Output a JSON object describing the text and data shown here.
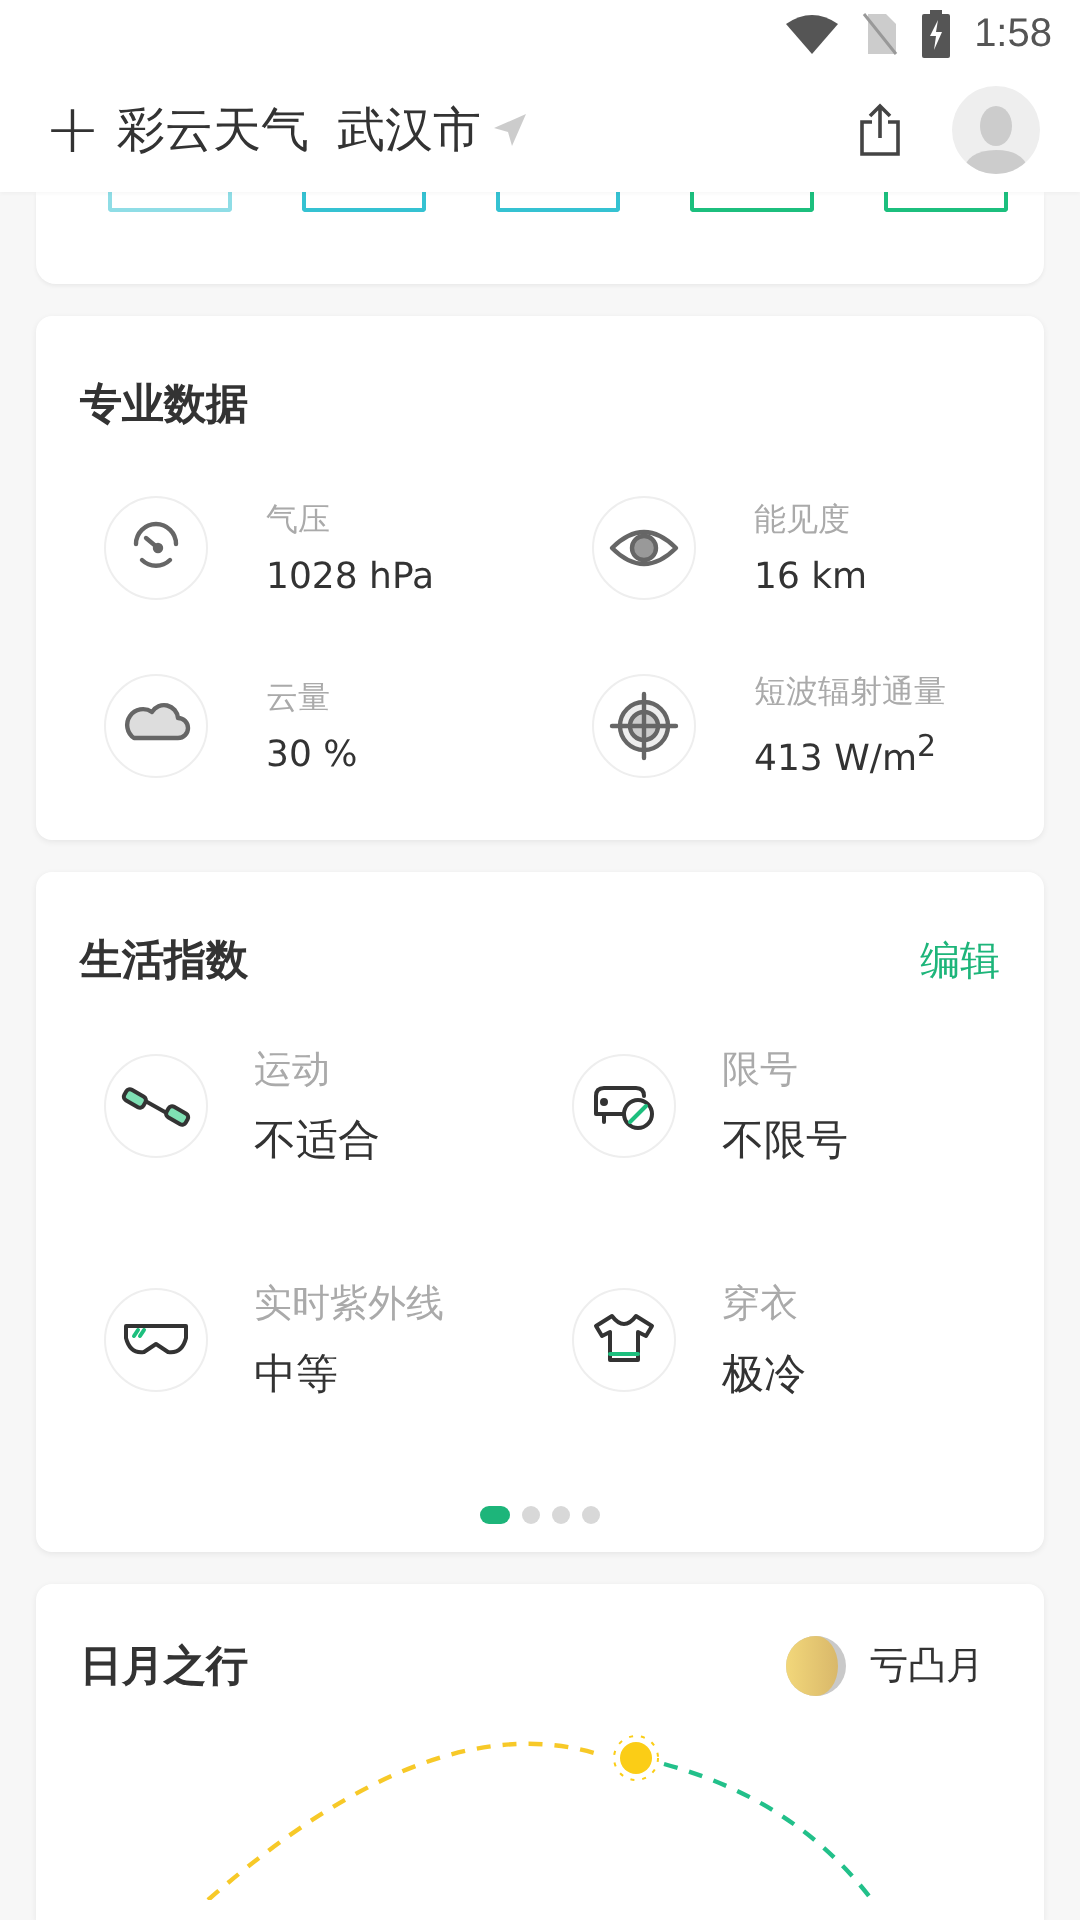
{
  "status_bar": {
    "time": "1:58"
  },
  "header": {
    "add": "+",
    "title": "彩云天气",
    "city": "武汉市"
  },
  "aqi_chips": [
    {
      "color": "#8fdde6"
    },
    {
      "color": "#35c2d2"
    },
    {
      "color": "#35c2d2"
    },
    {
      "color": "#1cbf7e"
    },
    {
      "color": "#1cbf7e"
    }
  ],
  "pro_data": {
    "title": "专业数据",
    "items": [
      {
        "label": "气压",
        "value": "1028 hPa"
      },
      {
        "label": "能见度",
        "value": "16 km"
      },
      {
        "label": "云量",
        "value": "30 %"
      },
      {
        "label": "短波辐射通量",
        "value": "413 W/m$^{2}$"
      }
    ]
  },
  "life_index": {
    "title": "生活指数",
    "edit": "编辑",
    "items": [
      {
        "label": "运动",
        "value": "不适合"
      },
      {
        "label": "限号",
        "value": "不限号"
      },
      {
        "label": "实时紫外线",
        "value": "中等"
      },
      {
        "label": "穿衣",
        "value": "极冷"
      }
    ],
    "pager": [
      {
        "selected": true
      },
      {
        "selected": false
      },
      {
        "selected": false
      },
      {
        "selected": false
      }
    ]
  },
  "sun_moon": {
    "title": "日月之行",
    "moon_phase": "亏凸月"
  }
}
